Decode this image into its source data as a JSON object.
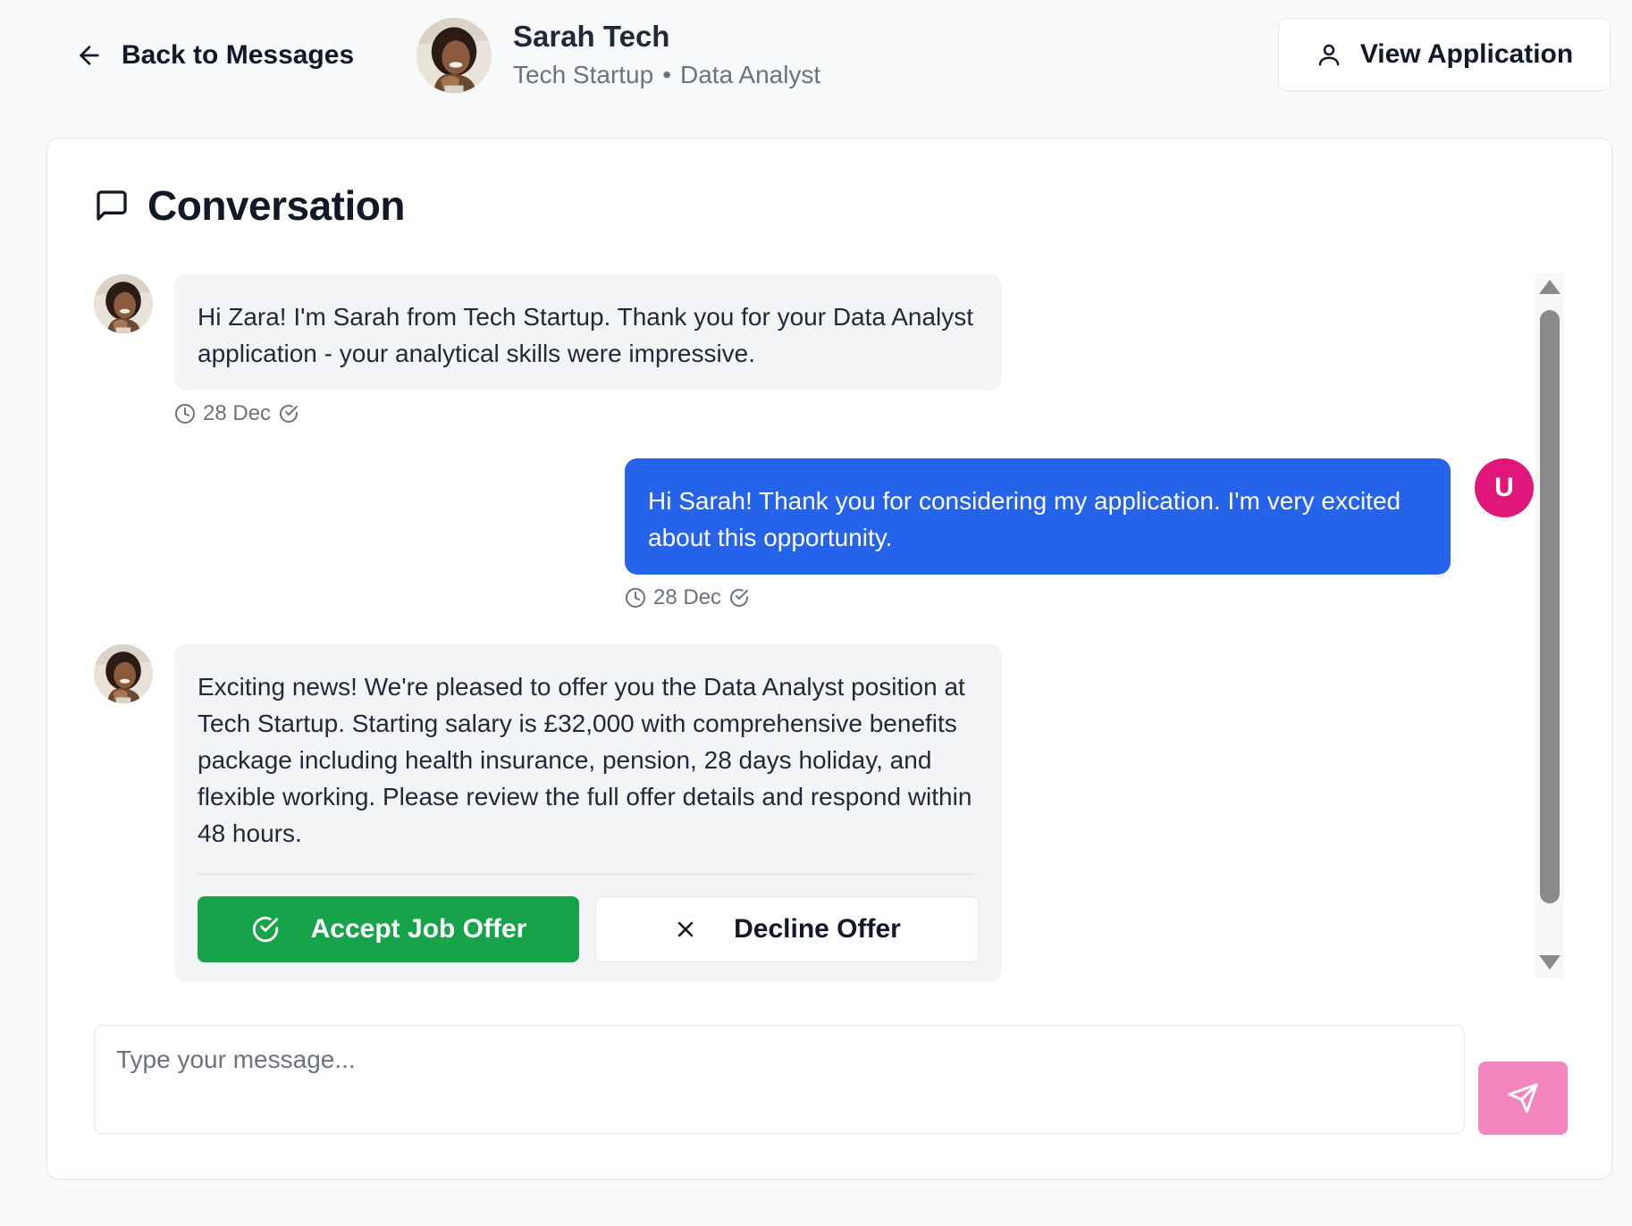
{
  "header": {
    "back_label": "Back to Messages",
    "contact_name": "Sarah Tech",
    "contact_company": "Tech Startup",
    "contact_separator": "•",
    "contact_role": "Data Analyst",
    "view_application_label": "View Application"
  },
  "conversation": {
    "title": "Conversation",
    "messages": [
      {
        "sender": "Sarah Tech",
        "direction": "incoming",
        "text": "Hi Zara! I'm Sarah from Tech Startup. Thank you for your Data Analyst application - your analytical skills were impressive.",
        "date": "28 Dec"
      },
      {
        "sender": "user",
        "avatar_initial": "U",
        "direction": "outgoing",
        "text": "Hi Sarah! Thank you for considering my application. I'm very excited about this opportunity.",
        "date": "28 Dec"
      },
      {
        "sender": "Sarah Tech",
        "direction": "incoming",
        "text": "Exciting news! We're pleased to offer you the Data Analyst position at Tech Startup. Starting salary is £32,000 with comprehensive benefits package including health insurance, pension, 28 days holiday, and flexible working. Please review the full offer details and respond within 48 hours.",
        "actions": {
          "accept_label": "Accept Job Offer",
          "decline_label": "Decline Offer"
        }
      }
    ]
  },
  "composer": {
    "placeholder": "Type your message...",
    "value": ""
  },
  "icons": {
    "back": "arrow-left-icon",
    "view_application": "user-icon",
    "conversation": "message-square-icon",
    "timestamp": "clock-icon",
    "read": "check-circle-icon",
    "accept": "check-circle-icon",
    "decline": "x-icon",
    "send": "send-icon"
  },
  "colors": {
    "page_background": "#f8f9fb",
    "outgoing_bubble": "#2563eb",
    "incoming_bubble": "#f3f4f6",
    "accept_button": "#16a34a",
    "user_avatar": "#e0167a",
    "send_button": "#f285bd"
  }
}
